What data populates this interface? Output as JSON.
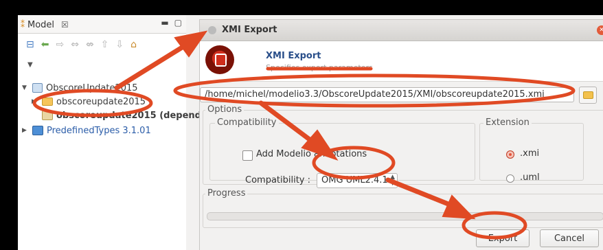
{
  "model_panel": {
    "tab_label": "Model",
    "tab_close": "☒",
    "tree": [
      {
        "label": "ObscoreUpdate2015",
        "icon": "package-icon",
        "expanded": true
      },
      {
        "label": "obscoreupdate2015",
        "icon": "folder-icon"
      },
      {
        "label": "obscoreupdate2015 (depend",
        "icon": "dependency-icon"
      },
      {
        "label": "PredefinedTypes 3.1.01",
        "icon": "types-icon"
      }
    ]
  },
  "dialog": {
    "title": "XMI Export",
    "banner_title": "XMI Export",
    "banner_subtitle": "Specifies export parameters",
    "path_value": "/home/michel/modelio3.3/ObscoreUpdate2015/XMI/obscoreupdate2015.xmi",
    "options_label": "Options",
    "compatibility_group_label": "Compatibility",
    "add_annotations_label": "Add Modelio annotations",
    "add_annotations_checked": false,
    "compatibility_label": "Compatibility :",
    "compatibility_value": "OMG UML2.4.1",
    "extension_group_label": "Extension",
    "extension_options": [
      ".xmi",
      ".uml"
    ],
    "extension_selected": ".xmi",
    "progress_label": "Progress",
    "progress_value": 0,
    "export_label": "Export",
    "cancel_label": "Cancel"
  },
  "colors": {
    "annotation_red": "#e04a24",
    "link_blue": "#2a5ca8",
    "radio_selected": "#e2553c"
  }
}
